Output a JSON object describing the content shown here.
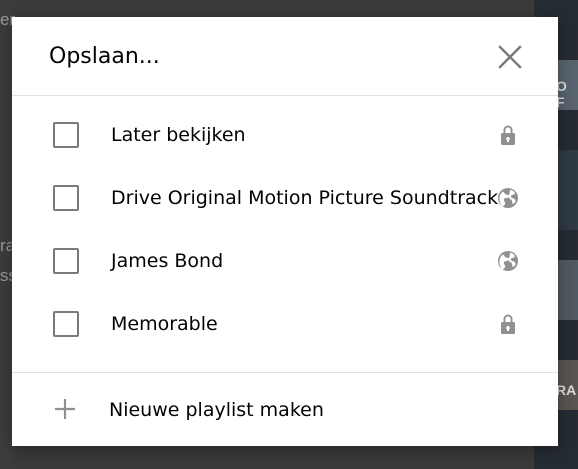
{
  "background": {
    "left_fragments": [
      "er",
      "ra",
      "ss"
    ],
    "right_fragments": [
      "O F",
      "RA"
    ]
  },
  "dialog": {
    "title": "Opslaan...",
    "close_icon": "close-icon",
    "playlists": [
      {
        "label": "Later bekijken",
        "checked": false,
        "privacy_icon": "lock-icon"
      },
      {
        "label": "Drive Original Motion Picture Soundtrack",
        "checked": false,
        "privacy_icon": "globe-icon"
      },
      {
        "label": "James Bond",
        "checked": false,
        "privacy_icon": "globe-icon"
      },
      {
        "label": "Memorable",
        "checked": false,
        "privacy_icon": "lock-icon"
      }
    ],
    "create_label": "Nieuwe playlist maken",
    "create_icon": "plus-icon"
  },
  "colors": {
    "icon_gray": "#909090",
    "text": "#030303",
    "divider": "#e0e0e0",
    "checkbox_border": "#7a7a7a"
  }
}
